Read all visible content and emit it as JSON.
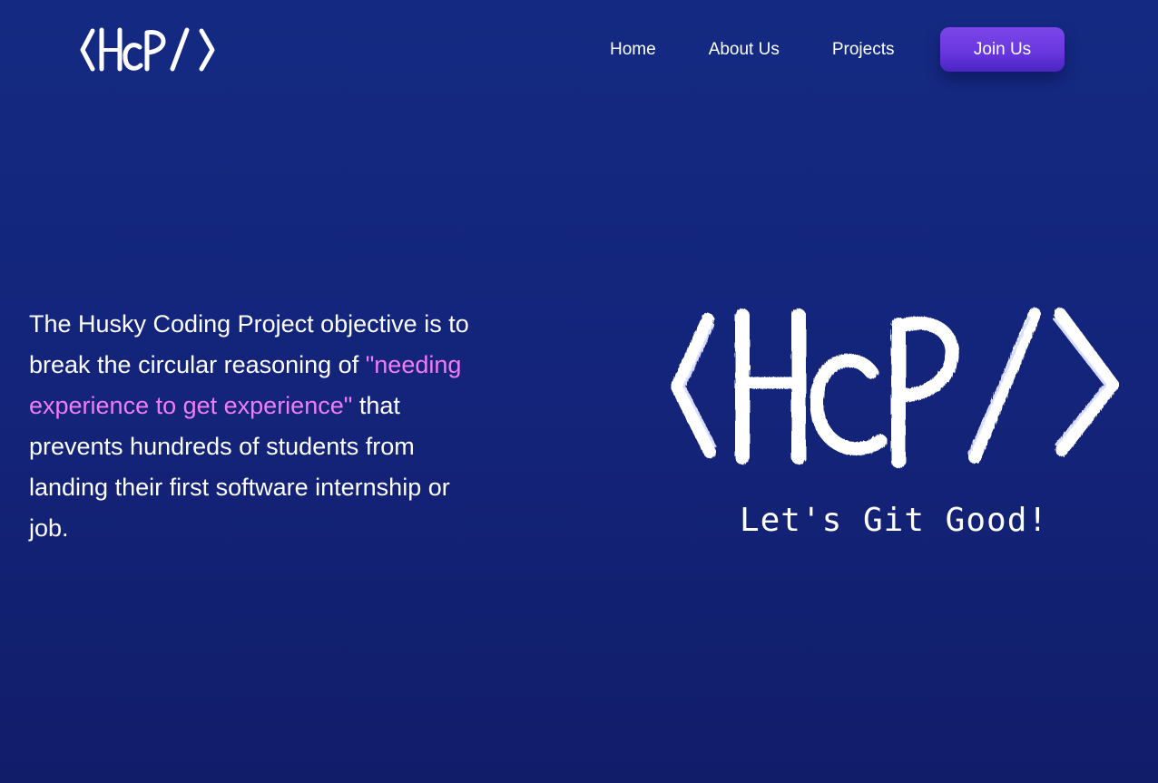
{
  "nav": {
    "logo_text": "<HCP/>",
    "links": [
      {
        "label": "Home"
      },
      {
        "label": "About Us"
      },
      {
        "label": "Projects"
      }
    ],
    "cta_label": "Join Us"
  },
  "hero": {
    "text_part1": "The Husky Coding Project objective is to break the circular reasoning of ",
    "highlight": "\"needing experience to get experience\"",
    "text_part2": " that prevents hundreds of students from landing their first software internship or job.",
    "logo_text": "<HCP/>",
    "tagline": "Let's Git Good!"
  },
  "colors": {
    "background": "#13247a",
    "highlight": "#f07cf6",
    "button": "#6a38e0"
  }
}
